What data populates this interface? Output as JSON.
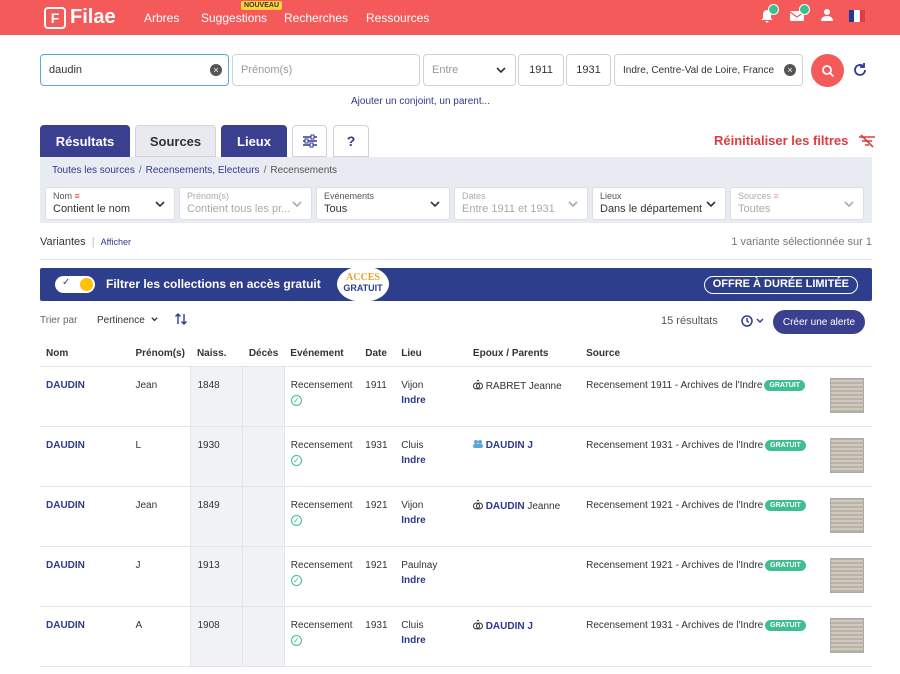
{
  "brand": {
    "name": "Filae",
    "accent": "#f45a5a",
    "primary": "#3a3f8f"
  },
  "nav": {
    "items": [
      "Arbres",
      "Suggestions",
      "Recherches",
      "Ressources"
    ],
    "new_badge": "NOUVEAU"
  },
  "search": {
    "name_value": "daudin",
    "firstname_placeholder": "Prénom(s)",
    "between_label": "Entre",
    "year_from": "1911",
    "year_to": "1931",
    "place_value": "Indre, Centre-Val de Loire, France",
    "add_link": "Ajouter un conjoint, un parent..."
  },
  "tabs": {
    "results": "Résultats",
    "sources": "Sources",
    "places": "Lieux",
    "help": "?"
  },
  "reset_filters": "Réinitialiser les filtres",
  "breadcrumb": {
    "all": "Toutes les sources",
    "census": "Recensements, Electeurs",
    "current": "Recensements"
  },
  "filters": [
    {
      "label": "Nom",
      "value": "Contient le nom"
    },
    {
      "label": "Prénom(s)",
      "value": "Contient tous les pr..."
    },
    {
      "label": "Evénements",
      "value": "Tous"
    },
    {
      "label": "Dates",
      "value": "Entre 1911 et 1931"
    },
    {
      "label": "Lieux",
      "value": "Dans le département"
    },
    {
      "label": "Sources",
      "value": "Toutes"
    }
  ],
  "variants": {
    "label": "Variantes",
    "show": "Afficher",
    "selected": "1 variante sélectionnée sur 1"
  },
  "banner": {
    "text": "Filtrer les collections en accès gratuit",
    "acces": "ACCES",
    "gratuit": "GRATUIT",
    "offer": "OFFRE À DURÉE LIMITÉE"
  },
  "sort": {
    "label": "Trier par",
    "value": "Pertinence",
    "count": "15 résultats",
    "alert": "Créer une alerte"
  },
  "columns": [
    "Nom",
    "Prénom(s)",
    "Naiss.",
    "Décès",
    "Evénement",
    "Date",
    "Lieu",
    "Epoux / Parents",
    "Source"
  ],
  "rows": [
    {
      "nom": "DAUDIN",
      "prenom": "Jean",
      "naiss": "1848",
      "deces": "",
      "event": "Recensement",
      "date": "1911",
      "lieu": "Vijon",
      "dept": "Indre",
      "ep_pre": "",
      "ep_link": "",
      "ep_rest": "RABRET Jeanne",
      "source": "Recensement 1911 - Archives de l'Indre",
      "tag": "GRATUIT"
    },
    {
      "nom": "DAUDIN",
      "prenom": "L",
      "naiss": "1930",
      "deces": "",
      "event": "Recensement",
      "date": "1931",
      "lieu": "Cluis",
      "dept": "Indre",
      "ep_pre": "",
      "ep_link": "DAUDIN J",
      "ep_rest": "",
      "source": "Recensement 1931 - Archives de l'Indre",
      "tag": "GRATUIT"
    },
    {
      "nom": "DAUDIN",
      "prenom": "Jean",
      "naiss": "1849",
      "deces": "",
      "event": "Recensement",
      "date": "1921",
      "lieu": "Vijon",
      "dept": "Indre",
      "ep_pre": "",
      "ep_link": "DAUDIN",
      "ep_rest": " Jeanne",
      "source": "Recensement 1921 - Archives de l'Indre",
      "tag": "GRATUIT"
    },
    {
      "nom": "DAUDIN",
      "prenom": "J",
      "naiss": "1913",
      "deces": "",
      "event": "Recensement",
      "date": "1921",
      "lieu": "Paulnay",
      "dept": "Indre",
      "ep_pre": "",
      "ep_link": "",
      "ep_rest": "",
      "source": "Recensement 1921 - Archives de l'Indre",
      "tag": "GRATUIT"
    },
    {
      "nom": "DAUDIN",
      "prenom": "A",
      "naiss": "1908",
      "deces": "",
      "event": "Recensement",
      "date": "1931",
      "lieu": "Cluis",
      "dept": "Indre",
      "ep_pre": "",
      "ep_link": "DAUDIN J",
      "ep_rest": "",
      "source": "Recensement 1931 - Archives de l'Indre",
      "tag": "GRATUIT"
    }
  ]
}
